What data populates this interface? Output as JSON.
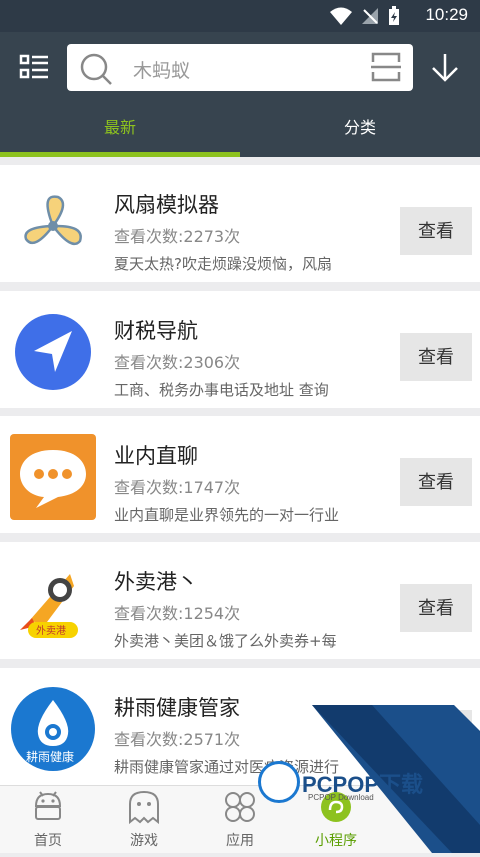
{
  "status": {
    "time": "10:29",
    "icons": [
      "wifi-icon",
      "signal-icon",
      "battery-icon"
    ]
  },
  "search": {
    "placeholder": "木蚂蚁",
    "icons": [
      "search-icon",
      "scan-icon"
    ]
  },
  "header_icons": [
    "list-menu-icon",
    "download-icon"
  ],
  "tabs": [
    {
      "label": "最新",
      "active": true
    },
    {
      "label": "分类",
      "active": false
    }
  ],
  "items": [
    {
      "name": "风扇模拟器",
      "views": "查看次数:2273次",
      "desc": "夏天太热?吹走烦躁没烦恼，风扇",
      "button": "查看",
      "icon": "fan-icon"
    },
    {
      "name": "财税导航",
      "views": "查看次数:2306次",
      "desc": "工商、税务办事电话及地址 查询",
      "button": "查看",
      "icon": "navigation-arrow-icon"
    },
    {
      "name": "业内直聊",
      "views": "查看次数:1747次",
      "desc": "业内直聊是业界领先的一对一行业",
      "button": "查看",
      "icon": "chat-bubble-icon"
    },
    {
      "name": "外卖港丶",
      "views": "查看次数:1254次",
      "desc": "外卖港丶美团＆饿了么外卖券+每",
      "button": "查看",
      "icon": "rocket-icon",
      "logo_text": "外卖港"
    },
    {
      "name": "耕雨健康管家",
      "views": "查看次数:2571次",
      "desc": "耕雨健康管家通过对医疗资源进行",
      "button": "查看",
      "icon": "health-drop-icon",
      "logo_text": "耕雨健康"
    }
  ],
  "bottom_nav": [
    {
      "label": "首页",
      "icon": "android-robot-icon",
      "active": false
    },
    {
      "label": "游戏",
      "icon": "ghost-icon",
      "active": false
    },
    {
      "label": "应用",
      "icon": "apps-grid-icon",
      "active": false
    },
    {
      "label": "小程序",
      "icon": "mini-program-icon",
      "active": true
    }
  ],
  "watermark": {
    "brand": "PCPOP下载",
    "sub": "PCPOP Download"
  },
  "colors": {
    "accent": "#8dc21f",
    "header": "#37444f",
    "statusbar": "#2e3a47"
  }
}
